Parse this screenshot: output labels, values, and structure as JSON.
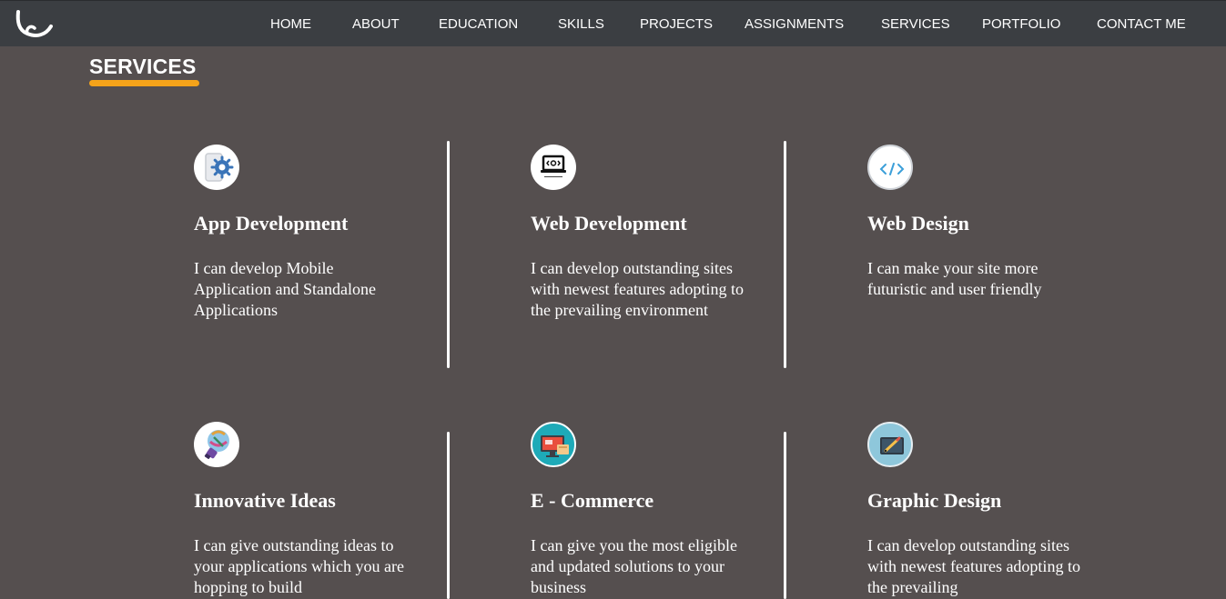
{
  "nav": {
    "links": [
      "HOME",
      "ABOUT",
      "EDUCATION",
      "SKILLS",
      "PROJECTS",
      "ASSIGNMENTS",
      "SERVICES",
      "PORTFOLIO",
      "CONTACT ME"
    ]
  },
  "section": {
    "title": "SERVICES"
  },
  "services": [
    {
      "title": "App Development",
      "description": "I can develop Mobile Application and Standalone Applications",
      "icon": "mobile-gear-icon"
    },
    {
      "title": "Web Development",
      "description": "I can develop outstanding sites with newest features adopting to the prevailing environment",
      "icon": "laptop-code-icon"
    },
    {
      "title": "Web Design",
      "description": "I can make your site more futuristic and user friendly",
      "icon": "code-tag-icon"
    },
    {
      "title": "Innovative Ideas",
      "description": "I can give outstanding ideas to your applications which you are hopping to build",
      "icon": "lightbulb-icon"
    },
    {
      "title": "E - Commerce",
      "description": "I can give you the most eligible and updated solutions to your business",
      "icon": "ecommerce-screen-icon"
    },
    {
      "title": "Graphic Design",
      "description": "I can develop outstanding sites with newest features adopting to the prevailing",
      "icon": "design-tablet-icon"
    }
  ],
  "colors": {
    "background": "#554f4f",
    "navbar": "#3b3e42",
    "accent": "#f5a31a",
    "text": "#ffffff"
  }
}
